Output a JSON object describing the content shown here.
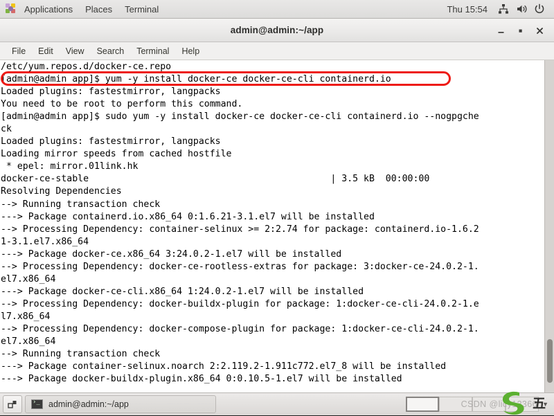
{
  "top_panel": {
    "app_icon": "applications-icon",
    "menus": [
      "Applications",
      "Places",
      "Terminal"
    ],
    "clock": "Thu 15:54",
    "tray_icons": [
      "network-icon",
      "volume-icon",
      "power-icon"
    ]
  },
  "window": {
    "title": "admin@admin:~/app",
    "controls": {
      "minimize": "minimize-icon",
      "maximize": "maximize-icon",
      "close": "close-icon"
    },
    "menubar": [
      "File",
      "Edit",
      "View",
      "Search",
      "Terminal",
      "Help"
    ]
  },
  "terminal": {
    "lines": [
      "/etc/yum.repos.d/docker-ce.repo",
      "[admin@admin app]$ yum -y install docker-ce docker-ce-cli containerd.io",
      "Loaded plugins: fastestmirror, langpacks",
      "You need to be root to perform this command.",
      "[admin@admin app]$ sudo yum -y install docker-ce docker-ce-cli containerd.io --nogpgche",
      "ck",
      "Loaded plugins: fastestmirror, langpacks",
      "Loading mirror speeds from cached hostfile",
      " * epel: mirror.01link.hk",
      "docker-ce-stable                                            | 3.5 kB  00:00:00",
      "Resolving Dependencies",
      "--> Running transaction check",
      "---> Package containerd.io.x86_64 0:1.6.21-3.1.el7 will be installed",
      "--> Processing Dependency: container-selinux >= 2:2.74 for package: containerd.io-1.6.2",
      "1-3.1.el7.x86_64",
      "---> Package docker-ce.x86_64 3:24.0.2-1.el7 will be installed",
      "--> Processing Dependency: docker-ce-rootless-extras for package: 3:docker-ce-24.0.2-1.",
      "el7.x86_64",
      "---> Package docker-ce-cli.x86_64 1:24.0.2-1.el7 will be installed",
      "--> Processing Dependency: docker-buildx-plugin for package: 1:docker-ce-cli-24.0.2-1.e",
      "l7.x86_64",
      "--> Processing Dependency: docker-compose-plugin for package: 1:docker-ce-cli-24.0.2-1.",
      "el7.x86_64",
      "--> Running transaction check",
      "---> Package container-selinux.noarch 2:2.119.2-1.911c772.el7_8 will be installed",
      "---> Package docker-buildx-plugin.x86_64 0:0.10.5-1.el7 will be installed"
    ],
    "highlight": {
      "line_index": 1,
      "color": "#ee1b16"
    },
    "scrollbar": {
      "thumb_top_pct": 84,
      "thumb_height_pct": 13
    }
  },
  "taskbar": {
    "show_desktop_icon": "show-desktop-icon",
    "task_icon": "terminal-icon",
    "task_label": "admin@admin:~/app",
    "workspaces": 4,
    "active_workspace": 1
  },
  "watermark": {
    "text": "CSDN @licy12366",
    "cn_char": "五"
  }
}
